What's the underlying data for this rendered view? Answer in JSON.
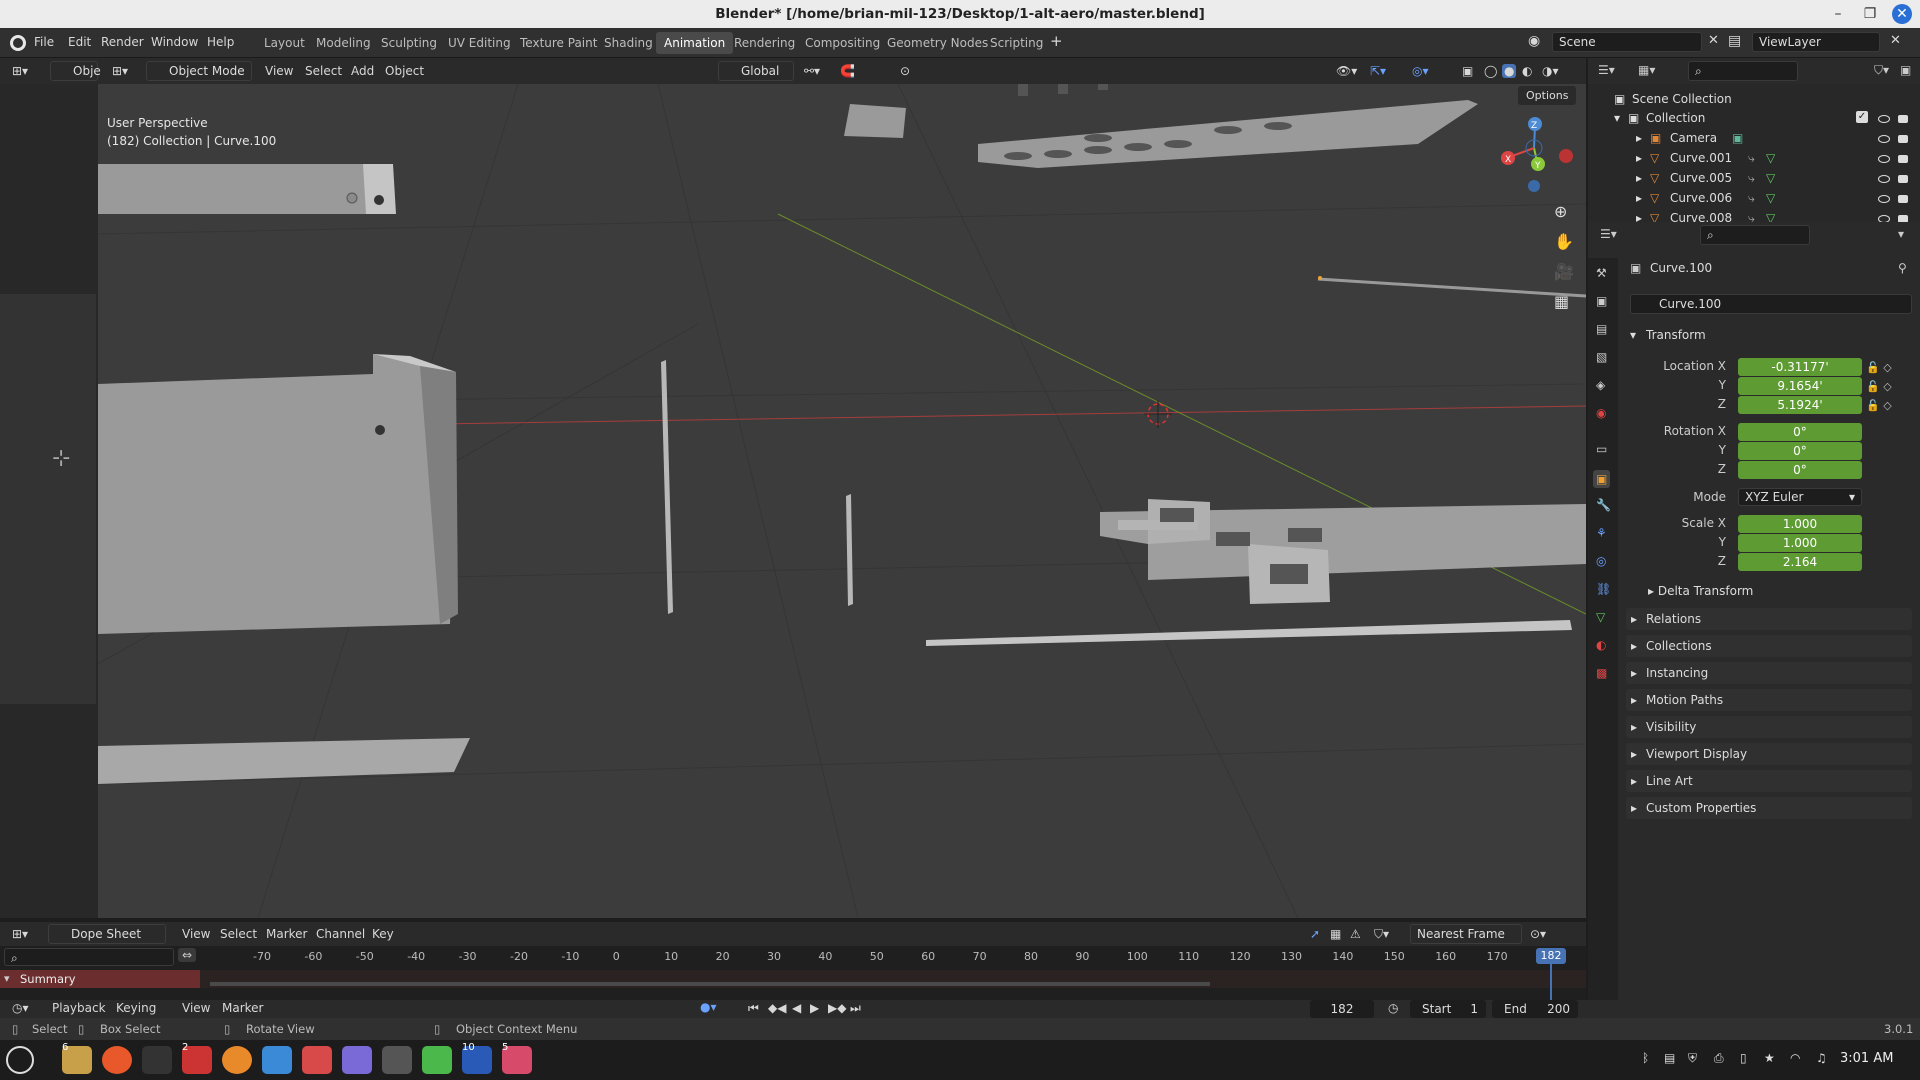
{
  "window": {
    "title": "Blender* [/home/brian-mil-123/Desktop/1-alt-aero/master.blend]"
  },
  "menu": [
    "File",
    "Edit",
    "Render",
    "Window",
    "Help"
  ],
  "workspaces": [
    "Layout",
    "Modeling",
    "Sculpting",
    "UV Editing",
    "Texture Paint",
    "Shading",
    "Animation",
    "Rendering",
    "Compositing",
    "Geometry Nodes",
    "Scripting"
  ],
  "active_workspace": "Animation",
  "scene": "Scene",
  "view_layer": "ViewLayer",
  "viewport": {
    "left_mode_short": "Obje",
    "mode": "Object Mode",
    "menu": [
      "View",
      "Select",
      "Add",
      "Object"
    ],
    "orientation": "Global",
    "options": "Options",
    "perspective": "User Perspective",
    "context": "(182) Collection | Curve.100"
  },
  "outliner": {
    "root": "Scene Collection",
    "collection": "Collection",
    "items": [
      "Camera",
      "Curve.001",
      "Curve.005",
      "Curve.006",
      "Curve.008"
    ]
  },
  "properties": {
    "object_name": "Curve.100",
    "datablock": "Curve.100",
    "transform_label": "Transform",
    "location_label": "Location X",
    "rotation_label": "Rotation X",
    "scale_label": "Scale X",
    "y": "Y",
    "z": "Z",
    "location": {
      "x": "-0.31177'",
      "y": "9.1654'",
      "z": "5.1924'"
    },
    "rotation": {
      "x": "0°",
      "y": "0°",
      "z": "0°"
    },
    "mode_label": "Mode",
    "mode": "XYZ Euler",
    "scale": {
      "x": "1.000",
      "y": "1.000",
      "z": "2.164"
    },
    "delta": "Delta Transform",
    "panels": [
      "Relations",
      "Collections",
      "Instancing",
      "Motion Paths",
      "Visibility",
      "Viewport Display",
      "Line Art",
      "Custom Properties"
    ]
  },
  "dopesheet": {
    "editor": "Dope Sheet",
    "menu": [
      "View",
      "Select",
      "Marker",
      "Channel",
      "Key"
    ],
    "snap": "Nearest Frame",
    "summary": "Summary",
    "ticks": [
      "-70",
      "-60",
      "-50",
      "-40",
      "-30",
      "-20",
      "-10",
      "0",
      "10",
      "20",
      "30",
      "40",
      "50",
      "60",
      "70",
      "80",
      "90",
      "100",
      "110",
      "120",
      "130",
      "140",
      "150",
      "160",
      "170"
    ],
    "current_frame": "182"
  },
  "playback": {
    "menu": [
      "Playback",
      "Keying",
      "View",
      "Marker"
    ],
    "frame": "182",
    "start_label": "Start",
    "start": "1",
    "end_label": "End",
    "end": "200"
  },
  "status": {
    "select": "Select",
    "box_select": "Box Select",
    "rotate": "Rotate View",
    "context_menu": "Object Context Menu",
    "version": "3.0.1"
  },
  "taskbar": {
    "time": "3:01 AM",
    "badge_files": "6",
    "badge_blender": "2",
    "badge_mail": "10",
    "badge_photo": "5"
  },
  "colors": {
    "field_green": "#5e9c33",
    "accent_blue": "#4772b3"
  }
}
